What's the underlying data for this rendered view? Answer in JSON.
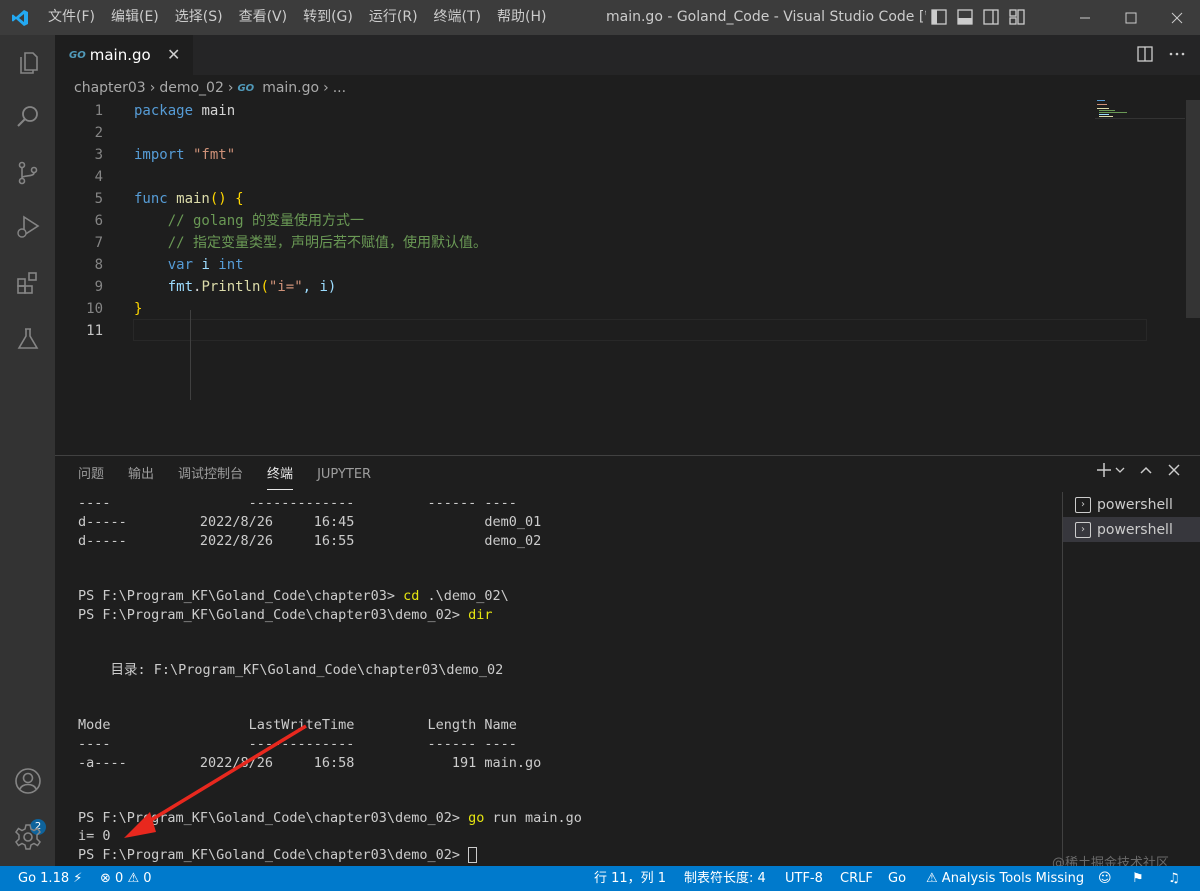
{
  "menu": [
    "文件(F)",
    "编辑(E)",
    "选择(S)",
    "查看(V)",
    "转到(G)",
    "运行(R)",
    "终端(T)",
    "帮助(H)"
  ],
  "window_title": "main.go - Goland_Code - Visual Studio Code [管理...",
  "tab": {
    "badge": "GO",
    "label": "main.go",
    "close": "✕"
  },
  "breadcrumb": [
    "chapter03",
    "demo_02",
    "main.go",
    "..."
  ],
  "code_lines": [
    {
      "n": "1"
    },
    {
      "n": "2"
    },
    {
      "n": "3"
    },
    {
      "n": "4"
    },
    {
      "n": "5"
    },
    {
      "n": "6"
    },
    {
      "n": "7"
    },
    {
      "n": "8"
    },
    {
      "n": "9"
    },
    {
      "n": "10"
    },
    {
      "n": "11"
    }
  ],
  "code": {
    "l1a": "package",
    "l1b": " main",
    "l3a": "import",
    "l3b": " \"fmt\"",
    "l5a": "func",
    "l5b": " main",
    "l5c": "()",
    "l5d": " {",
    "l6": "    // golang 的变量使用方式一",
    "l7": "    // 指定变量类型，声明后若不赋值，使用默认值。",
    "l8a": "    var",
    "l8b": " i",
    "l8c": " int",
    "l9a": "    fmt",
    "l9b": ".",
    "l9c": "Println",
    "l9d": "(",
    "l9e": "\"i=\"",
    "l9f": ", i)",
    "l10": "}"
  },
  "panel_tabs": [
    "问题",
    "输出",
    "调试控制台",
    "终端",
    "JUPYTER"
  ],
  "terminal_lines": [
    "----                 -------------         ------ ----",
    "d-----         2022/8/26     16:45                dem0_01",
    "d-----         2022/8/26     16:55                demo_02",
    "",
    "",
    "PS F:\\Program_KF\\Goland_Code\\chapter03> ",
    "PS F:\\Program_KF\\Goland_Code\\chapter03\\demo_02> ",
    "",
    "",
    "    目录: F:\\Program_KF\\Goland_Code\\chapter03\\demo_02",
    "",
    "",
    "Mode                 LastWriteTime         Length Name",
    "----                 -------------         ------ ----",
    "-a----         2022/8/26     16:58            191 main.go",
    "",
    "",
    "PS F:\\Program_KF\\Goland_Code\\chapter03\\demo_02> ",
    "i= 0",
    "PS F:\\Program_KF\\Goland_Code\\chapter03\\demo_02> "
  ],
  "terminal_cmds": {
    "cd_cmd": "cd",
    "cd_arg": " .\\demo_02\\",
    "dir_cmd": "dir",
    "go_cmd": "go",
    "go_arg": " run main.go"
  },
  "terminals": [
    "powershell",
    "powershell"
  ],
  "watermark": "@稀土掘金技术社区",
  "status": {
    "go_version": "Go 1.18",
    "errors": "0",
    "warnings": "0",
    "position": "行 11，列 1",
    "tab_size": "制表符长度: 4",
    "encoding": "UTF-8",
    "eol": "CRLF",
    "language": "Go",
    "analysis": "Analysis Tools Missing"
  },
  "notification_count": "2",
  "colors": {
    "statusbar": "#007acc",
    "titlebar": "#3c3c3c",
    "activitybar": "#333333",
    "editor": "#1e1e1e",
    "arrow": "#e8281e"
  }
}
